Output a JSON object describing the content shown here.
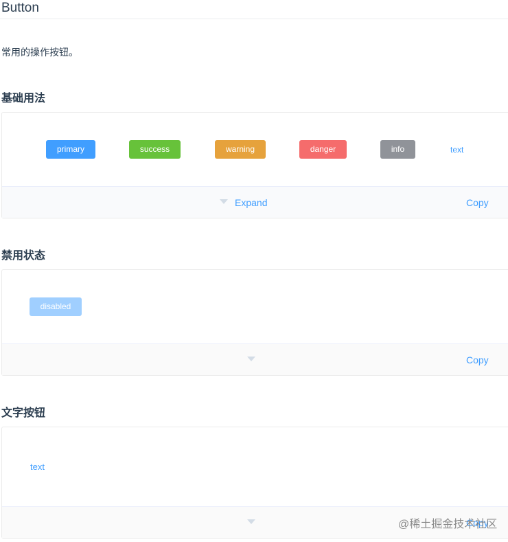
{
  "title": "Button",
  "description": "常用的操作按钮。",
  "sections": [
    {
      "heading": "基础用法",
      "expand_label": "Expand",
      "copy_label": "Copy",
      "buttons": [
        {
          "label": "primary",
          "color": "#409eff"
        },
        {
          "label": "success",
          "color": "#67c23a"
        },
        {
          "label": "warning",
          "color": "#e6a23c"
        },
        {
          "label": "danger",
          "color": "#f56c6c"
        },
        {
          "label": "info",
          "color": "#909399"
        },
        {
          "label": "text"
        }
      ]
    },
    {
      "heading": "禁用状态",
      "copy_label": "Copy",
      "buttons": [
        {
          "label": "disabled",
          "color": "#a0cfff"
        }
      ]
    },
    {
      "heading": "文字按钮",
      "copy_label": "Copy",
      "buttons": [
        {
          "label": "text"
        }
      ]
    }
  ],
  "watermark": "@稀土掘金技术社区"
}
